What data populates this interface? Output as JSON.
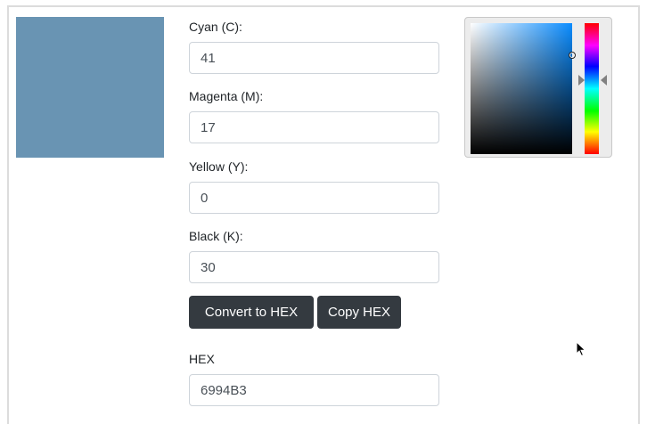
{
  "swatch": {
    "color": "#6994B3"
  },
  "fields": {
    "cyan": {
      "label": "Cyan (C):",
      "value": "41"
    },
    "magenta": {
      "label": "Magenta (M):",
      "value": "17"
    },
    "yellow": {
      "label": "Yellow (Y):",
      "value": "0"
    },
    "black": {
      "label": "Black (K):",
      "value": "30"
    }
  },
  "buttons": {
    "convert_label": "Convert to HEX",
    "copy_label": "Copy HEX"
  },
  "hex": {
    "label": "HEX",
    "value": "6994B3"
  },
  "picker": {
    "hue_color": "#0a8cff"
  },
  "icons": {
    "cursor": "mouse-pointer-icon"
  }
}
